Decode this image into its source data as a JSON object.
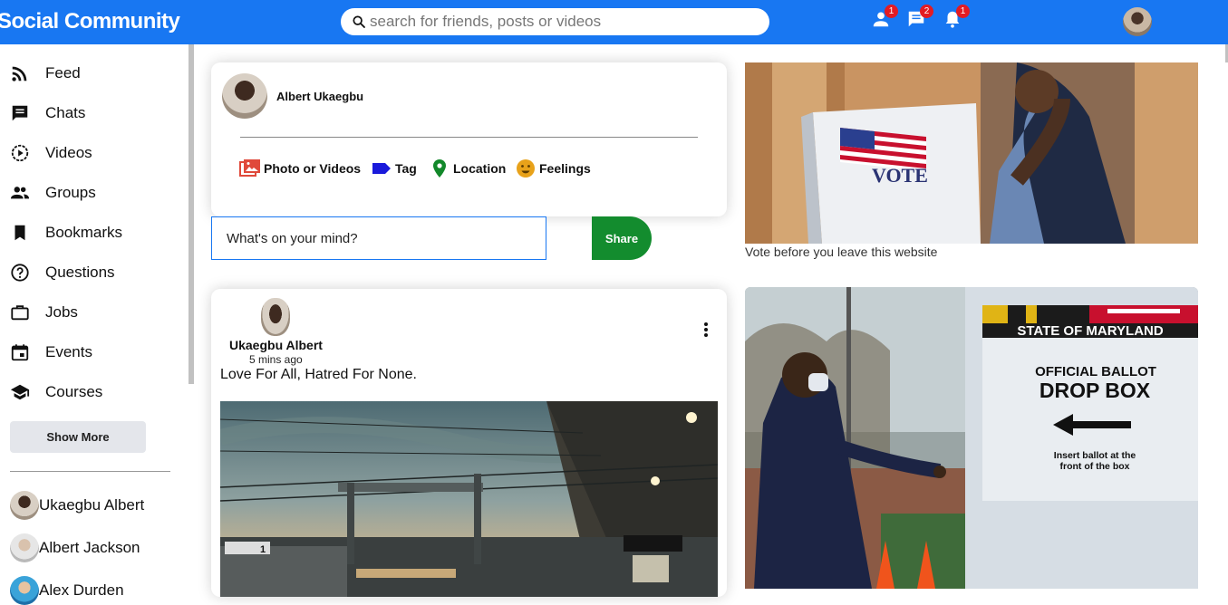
{
  "header": {
    "logo": "Social Community",
    "search_placeholder": "search for friends, posts or videos",
    "badges": {
      "friends": "1",
      "messages": "2",
      "notifications": "1"
    }
  },
  "sidebar": {
    "items": [
      {
        "label": "Feed",
        "icon": "rss-icon"
      },
      {
        "label": "Chats",
        "icon": "chat-icon"
      },
      {
        "label": "Videos",
        "icon": "play-circle-icon"
      },
      {
        "label": "Groups",
        "icon": "group-icon"
      },
      {
        "label": "Bookmarks",
        "icon": "bookmark-icon"
      },
      {
        "label": "Questions",
        "icon": "help-icon"
      },
      {
        "label": "Jobs",
        "icon": "briefcase-icon"
      },
      {
        "label": "Events",
        "icon": "calendar-icon"
      },
      {
        "label": "Courses",
        "icon": "school-icon"
      }
    ],
    "show_more": "Show More",
    "friends": [
      "Ukaegbu Albert",
      "Albert Jackson",
      "Alex Durden"
    ]
  },
  "share": {
    "user_name": "Albert Ukaegbu",
    "options": [
      "Photo or Videos",
      "Tag",
      "Location",
      "Feelings"
    ],
    "input_placeholder": "What's on your mind?",
    "share_button": "Share"
  },
  "post": {
    "author": "Ukaegbu Albert",
    "time": "5 mins ago",
    "text": "Love For All, Hatred For None."
  },
  "ads": {
    "ad1_sign": "VOTE",
    "ad1_caption": "Vote before you leave this website",
    "ad2_state": "STATE OF MARYLAND",
    "ad2_title1": "OFFICIAL BALLOT",
    "ad2_title2": "DROP BOX",
    "ad2_instr1": "Insert ballot at the",
    "ad2_instr2": "front of the box"
  },
  "colors": {
    "brand": "#1877f2",
    "share_button": "#138c2e",
    "badge": "#e31b23"
  }
}
